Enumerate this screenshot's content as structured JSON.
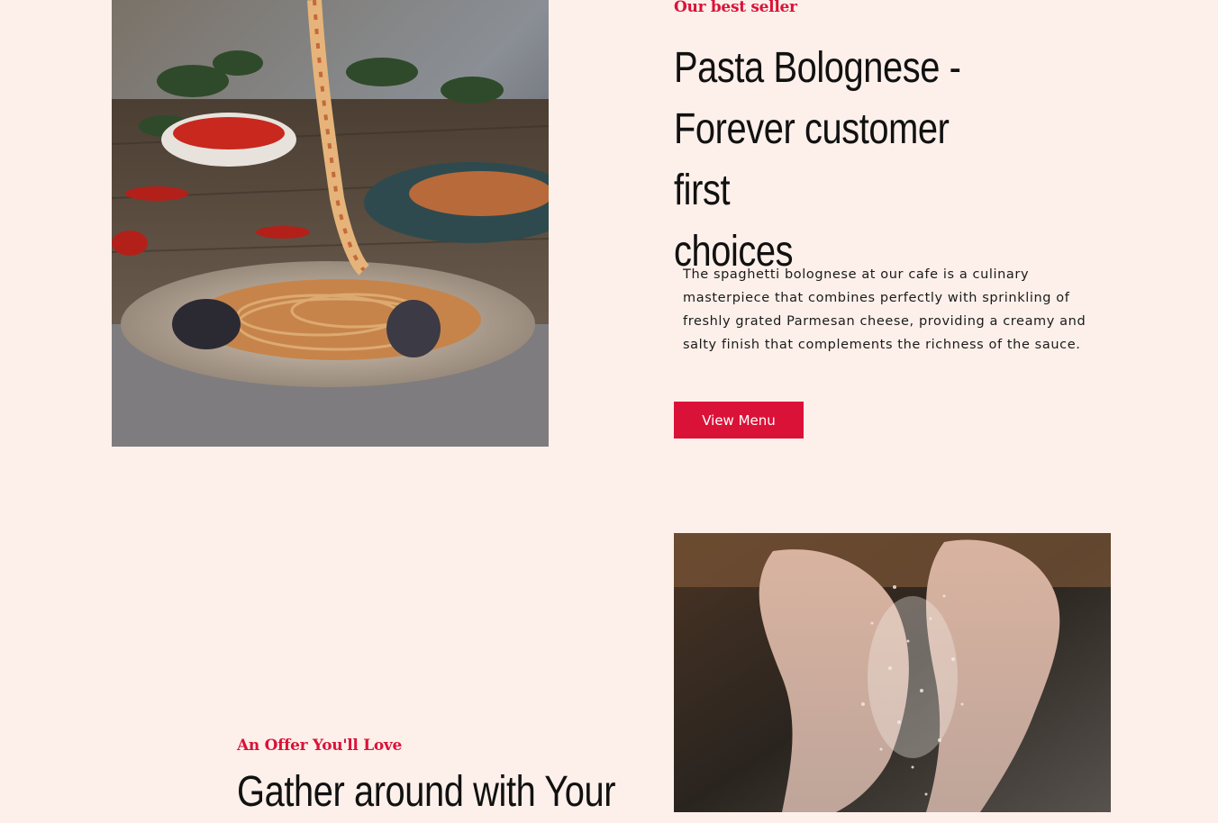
{
  "colors": {
    "background": "#fdf0ea",
    "accent": "#db1238",
    "heading": "#111111"
  },
  "best_seller": {
    "eyebrow": "Our best seller",
    "headline_line1": "Pasta Bolognese -",
    "headline_line2": "Forever customer first",
    "headline_line3": "choices",
    "description": "The spaghetti bolognese at our cafe is a culinary masterpiece that combines perfectly with sprinkling of freshly grated Parmesan cheese, providing a creamy and salty finish that complements the richness of the sauce.",
    "button_label": "View Menu"
  },
  "offer": {
    "eyebrow": "An Offer You'll Love",
    "headline": "Gather around with Your"
  }
}
